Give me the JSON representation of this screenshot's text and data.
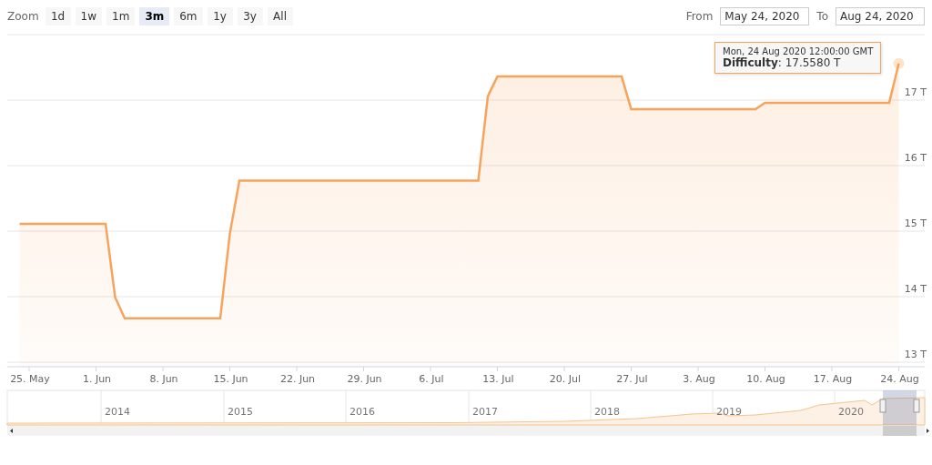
{
  "range_selector": {
    "label": "Zoom",
    "buttons": [
      {
        "label": "1d",
        "selected": false
      },
      {
        "label": "1w",
        "selected": false
      },
      {
        "label": "1m",
        "selected": false
      },
      {
        "label": "3m",
        "selected": true
      },
      {
        "label": "6m",
        "selected": false
      },
      {
        "label": "1y",
        "selected": false
      },
      {
        "label": "3y",
        "selected": false
      },
      {
        "label": "All",
        "selected": false
      }
    ]
  },
  "date_range": {
    "from_label": "From",
    "from": "May 24, 2020",
    "to_label": "To",
    "to": "Aug 24, 2020"
  },
  "chart": {
    "chart_data": {
      "type": "area",
      "categories": [
        null,
        "25. May",
        null,
        null,
        null,
        null,
        null,
        null,
        "1. Jun",
        null,
        null,
        null,
        null,
        null,
        null,
        "8. Jun",
        null,
        null,
        null,
        null,
        null,
        null,
        "15. Jun",
        null,
        null,
        null,
        null,
        null,
        null,
        "22. Jun",
        null,
        null,
        null,
        null,
        null,
        null,
        "29. Jun",
        null,
        null,
        null,
        null,
        null,
        null,
        "6. Jul",
        null,
        null,
        null,
        null,
        null,
        null,
        "13. Jul",
        null,
        null,
        null,
        null,
        null,
        null,
        "20. Jul",
        null,
        null,
        null,
        null,
        null,
        null,
        "27. Jul",
        null,
        null,
        null,
        null,
        null,
        null,
        "3. Aug",
        null,
        null,
        null,
        null,
        null,
        null,
        "10. Aug",
        null,
        null,
        null,
        null,
        null,
        null,
        "17. Aug",
        null,
        null,
        null,
        null,
        null,
        null,
        "24. Aug"
      ],
      "series": [
        {
          "name": "Difficulty",
          "color": "#f7a35c",
          "values": [
            15.11,
            15.11,
            15.11,
            15.11,
            15.11,
            15.11,
            15.11,
            15.11,
            15.11,
            15.11,
            13.99,
            13.67,
            13.67,
            13.67,
            13.67,
            13.67,
            13.67,
            13.67,
            13.67,
            13.67,
            13.67,
            13.67,
            14.96,
            15.77,
            15.77,
            15.77,
            15.77,
            15.77,
            15.77,
            15.77,
            15.77,
            15.77,
            15.77,
            15.77,
            15.77,
            15.77,
            15.77,
            15.77,
            15.77,
            15.77,
            15.77,
            15.77,
            15.77,
            15.77,
            15.77,
            15.77,
            15.77,
            15.77,
            15.77,
            17.06,
            17.36,
            17.36,
            17.36,
            17.36,
            17.36,
            17.36,
            17.36,
            17.36,
            17.36,
            17.36,
            17.36,
            17.36,
            17.36,
            17.36,
            16.86,
            16.86,
            16.86,
            16.86,
            16.86,
            16.86,
            16.86,
            16.86,
            16.86,
            16.86,
            16.86,
            16.86,
            16.86,
            16.86,
            16.96,
            16.96,
            16.96,
            16.96,
            16.96,
            16.96,
            16.96,
            16.96,
            16.96,
            16.96,
            16.96,
            16.96,
            16.96,
            16.96,
            17.56
          ]
        }
      ],
      "yticks": [
        {
          "value": 13,
          "label": "13 T"
        },
        {
          "value": 14,
          "label": "14 T"
        },
        {
          "value": 15,
          "label": "15 T"
        },
        {
          "value": 16,
          "label": "16 T"
        },
        {
          "value": 17,
          "label": "17 T"
        }
      ],
      "ylim": [
        13,
        18
      ],
      "grid": true
    },
    "tooltip": {
      "date": "Mon, 24 Aug 2020 12:00:00 GMT",
      "value": ": 17.5580 T"
    }
  },
  "navigator": {
    "year_labels": [
      "2014",
      "2015",
      "2016",
      "2017",
      "2018",
      "2019",
      "2020"
    ]
  }
}
